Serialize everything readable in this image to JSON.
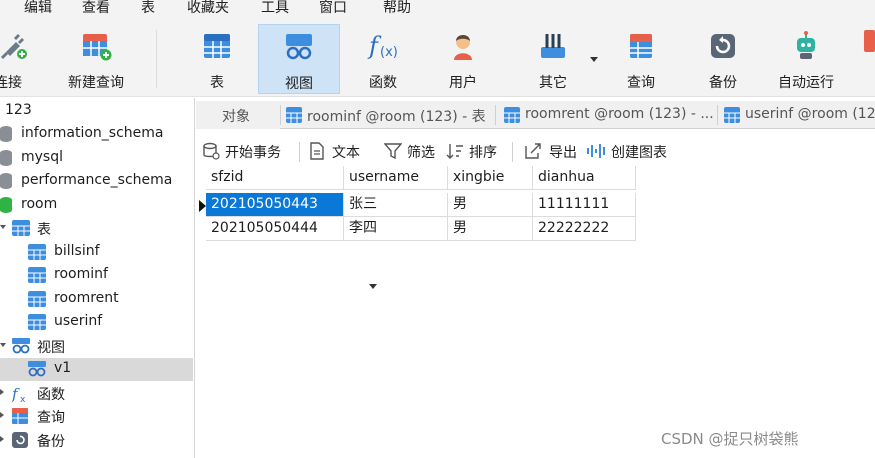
{
  "menu": [
    "编辑",
    "查看",
    "表",
    "收藏夹",
    "工具",
    "窗口",
    "帮助"
  ],
  "toolbar": {
    "connect": "连接",
    "new_query": "新建查询",
    "table": "表",
    "view": "视图",
    "function": "函数",
    "user": "用户",
    "other": "其它",
    "query": "查询",
    "backup": "备份",
    "auto_run": "自动运行"
  },
  "sidebar": {
    "connection": "123",
    "databases": [
      "information_schema",
      "mysql",
      "performance_schema",
      "room"
    ],
    "tables_group": "表",
    "tables": [
      "billsinf",
      "roominf",
      "roomrent",
      "userinf"
    ],
    "views_group": "视图",
    "views": [
      "v1"
    ],
    "functions_group": "函数",
    "queries_group": "查询",
    "backups_group": "备份"
  },
  "tabs": {
    "objects": "对象",
    "tab1": "roominf @room (123) - 表",
    "tab2": "roomrent @room (123) - ...",
    "tab3": "userinf @room (12"
  },
  "actions": {
    "begin_transaction": "开始事务",
    "text": "文本",
    "filter": "筛选",
    "sort": "排序",
    "export": "导出",
    "create_chart": "创建图表"
  },
  "table": {
    "columns": [
      "sfzid",
      "username",
      "xingbie",
      "dianhua"
    ],
    "rows": [
      [
        "202105050443",
        "张三",
        "男",
        "11111111"
      ],
      [
        "202105050444",
        "李四",
        "男",
        "22222222"
      ]
    ]
  },
  "watermark": "CSDN @捉只树袋熊",
  "colors": {
    "accent": "#0a78d7",
    "active_tool": "#cfe3f6",
    "selected_node": "#d9d9d9"
  }
}
